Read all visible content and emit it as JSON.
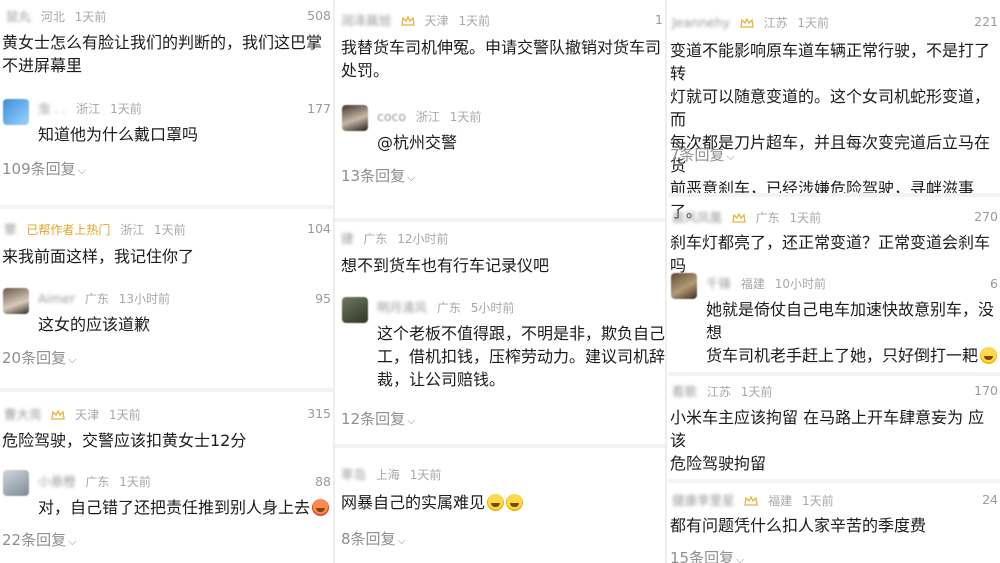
{
  "col1": {
    "block1": {
      "top_user": "鼠丸",
      "top_loc": "河北",
      "top_time": "1天前",
      "top_count": "508",
      "top_text": "黄女士怎么有脸让我们的判断的，我们这巴掌\n不进屏幕里",
      "reply_user": "虫 . .",
      "reply_loc": "浙江",
      "reply_time": "1天前",
      "reply_count": "177",
      "reply_text": "知道他为什么戴口罩吗",
      "more": "109条回复"
    },
    "block2": {
      "top_user": "覃",
      "top_tag": "已帮作者上热门",
      "top_loc": "浙江",
      "top_time": "1天前",
      "top_count": "104",
      "top_text": "来我前面这样，我记住你了",
      "reply_user": "Aimer",
      "reply_loc": "广东",
      "reply_time": "13小时前",
      "reply_count": "95",
      "reply_text": "这女的应该道歉",
      "more": "20条回复"
    },
    "block3": {
      "top_user": "曹大亮",
      "top_loc": "天津",
      "top_time": "1天前",
      "top_count": "315",
      "top_text": "危险驾驶，交警应该扣黄女士12分",
      "reply_user": "小悬橙",
      "reply_loc": "广东",
      "reply_time": "1天前",
      "reply_count": "88",
      "reply_text": "对，自己错了还把责任推到别人身上去",
      "more": "22条回复"
    }
  },
  "col2": {
    "block1": {
      "top_user": "润泽晨旭",
      "top_loc": "天津",
      "top_time": "1天前",
      "top_count": "1",
      "top_text": "我替货车司机伸冤。申请交警队撤销对货车司\n处罚。",
      "reply_user": "coco",
      "reply_loc": "浙江",
      "reply_time": "1天前",
      "reply_text": "@杭州交警",
      "more": "13条回复"
    },
    "block2": {
      "top_user": "捷",
      "top_loc": "广东",
      "top_time": "12小时前",
      "top_text": "想不到货车也有行车记录仪吧",
      "reply_user": "明月清风",
      "reply_loc": "广东",
      "reply_time": "5小时前",
      "reply_text": "这个老板不值得跟，不明是非，欺负自己\n工，借机扣钱，压榨劳动力。建议司机辞\n裁，让公司赔钱。",
      "more": "12条回复"
    },
    "block3": {
      "top_user": "莘岛",
      "top_loc": "上海",
      "top_time": "1天前",
      "top_text": "网暴自己的实属难见",
      "more": "8条回复"
    }
  },
  "col3": {
    "block1": {
      "top_user": "Jeannehy",
      "top_loc": "江苏",
      "top_time": "1天前",
      "top_count": "221",
      "top_text": "变道不能影响原车道车辆正常行驶，不是打了转\n灯就可以随意变道的。这个女司机蛇形变道，而\n每次都是刀片超车，并且每次变完道后立马在货\n前恶意刹车，已经涉嫌危险驾驶，寻衅滋事了。",
      "more": "7条回复"
    },
    "block2": {
      "top_user": "晨风凤凰",
      "top_loc": "广东",
      "top_time": "1天前",
      "top_count": "270",
      "top_text": "刹车灯都亮了，还正常变道？正常变道会刹车吗",
      "reply_user": "千锋",
      "reply_loc": "福建",
      "reply_time": "10小时前",
      "reply_count": "6",
      "reply_text": "她就是倚仗自己电车加速快故意别车，没想\n货车司机老手赶上了她，只好倒打一耙",
      "more": ""
    },
    "block3": {
      "top_user": "看歌",
      "top_loc": "江苏",
      "top_time": "1天前",
      "top_count": "170",
      "top_text": "小米车主应该拘留 在马路上开车肆意妄为 应该\n危险驾驶拘留"
    },
    "block4": {
      "top_user": "健康李里星",
      "top_loc": "福建",
      "top_time": "1天前",
      "top_count": "24",
      "top_text": "都有问题凭什么扣人家辛苦的季度费",
      "more": "15条回复"
    }
  },
  "icons": {
    "crown": "crown-badge-icon",
    "chevron": "chevron-down-icon",
    "emoji": "laugh-cry-emoji-icon"
  },
  "colors": {
    "meta": "#a8a8a8",
    "text": "#1b1b1b",
    "badge": "#e8a427",
    "more": "#8f8f8f"
  }
}
